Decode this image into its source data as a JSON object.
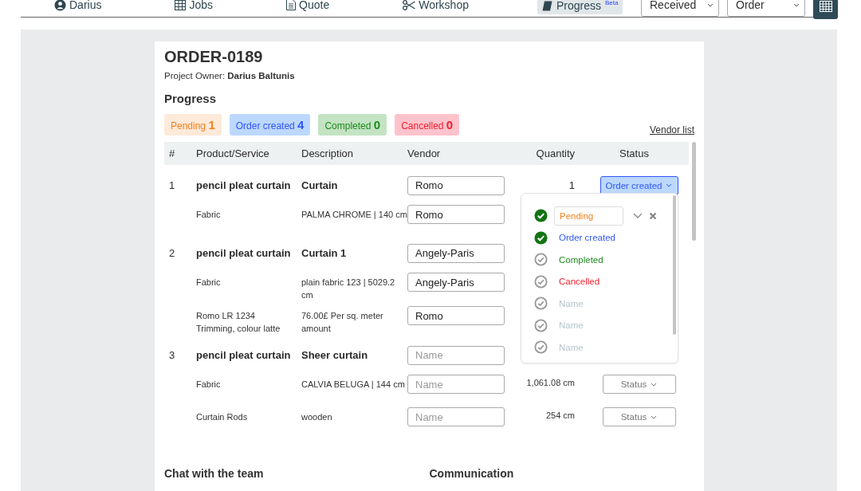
{
  "nav": {
    "items": [
      {
        "label": "Darius",
        "selected": false
      },
      {
        "label": "Jobs",
        "selected": false
      },
      {
        "label": "Quote",
        "selected": false
      },
      {
        "label": "Workshop",
        "selected": false
      },
      {
        "label": "Progress",
        "selected": true,
        "badge": "Beta"
      }
    ],
    "selects": [
      "Received",
      "Order"
    ]
  },
  "order": {
    "title": "ORDER-0189",
    "owner": "Project Owner: **Darius Baltunis**"
  },
  "progress": {
    "heading": "Progress",
    "counters": [
      {
        "label": "Pending",
        "count": "1",
        "kind": "pending"
      },
      {
        "label": "Order created",
        "count": "4",
        "kind": "created"
      },
      {
        "label": "Completed",
        "count": "0",
        "kind": "completed"
      },
      {
        "label": "Cancelled",
        "count": "0",
        "kind": "cancelled"
      }
    ],
    "vendor_link": "Vendor list"
  },
  "table": {
    "columns": [
      "#",
      "Product/Service",
      "Description",
      "Vendor",
      "Quantity",
      "Status"
    ],
    "rows": [
      {
        "kind": "main",
        "number": "1",
        "product": "pencil pleat curtain",
        "description": "Curtain",
        "vendor": "Romo",
        "quantity": "1",
        "status": {
          "label": "Order created",
          "kind": "created"
        }
      },
      {
        "kind": "sub",
        "product": "Fabric",
        "description": "PALMA CHROME | 140 cm",
        "vendor": "Romo"
      },
      {
        "kind": "main",
        "number": "2",
        "product": "pencil pleat curtain",
        "description": "Curtain 1",
        "vendor": "Angely-Paris"
      },
      {
        "kind": "sub",
        "product": "Fabric",
        "description": "plain fabric 123 | 5029.2 cm",
        "vendor": "Angely-Paris"
      },
      {
        "kind": "sub",
        "product": "Romo LR 1234 Trimming, colour latte",
        "description": "76.00£ Per sq. meter amount",
        "vendor": "Romo"
      },
      {
        "kind": "main",
        "number": "3",
        "product": "pencil pleat curtain",
        "description": "Sheer curtain",
        "vendor_placeholder": "Name"
      },
      {
        "kind": "sub",
        "product": "Fabric",
        "description": "CALVIA BELUGA | 144 cm",
        "vendor_placeholder": "Name",
        "quantity": "1,061.08 cm",
        "status": {
          "label": "Status",
          "kind": "none"
        }
      },
      {
        "kind": "sub",
        "product": "Curtain Rods",
        "description": "wooden",
        "vendor_placeholder": "Name",
        "quantity": "254 cm",
        "status": {
          "label": "Status",
          "kind": "none"
        }
      }
    ]
  },
  "status_menu": {
    "field": {
      "value": "Pending",
      "kind": "pending",
      "checked": true
    },
    "options": [
      {
        "label": "Order created",
        "kind": "created",
        "checked": true
      },
      {
        "label": "Completed",
        "kind": "completed",
        "checked": false
      },
      {
        "label": "Cancelled",
        "kind": "cancelled",
        "checked": false
      },
      {
        "label": "Name",
        "kind": "blank",
        "checked": false
      },
      {
        "label": "Name",
        "kind": "blank",
        "checked": false
      },
      {
        "label": "Name",
        "kind": "blank",
        "checked": false
      }
    ]
  },
  "sections": [
    "Chat with the team",
    "Communication"
  ]
}
